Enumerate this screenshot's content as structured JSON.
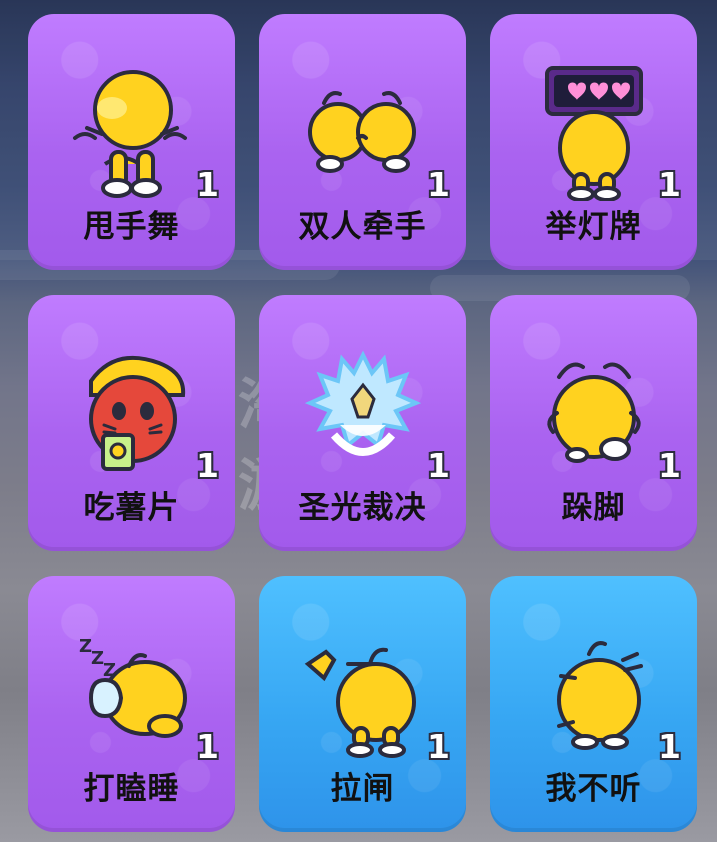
{
  "items": [
    {
      "name": "甩手舞",
      "count": "1",
      "theme": "purple",
      "icon": "dancing-chick-icon"
    },
    {
      "name": "双人牵手",
      "count": "1",
      "theme": "purple",
      "icon": "hand-holding-chicks-icon"
    },
    {
      "name": "举灯牌",
      "count": "1",
      "theme": "purple",
      "icon": "lightboard-chick-icon"
    },
    {
      "name": "吃薯片",
      "count": "1",
      "theme": "purple",
      "icon": "chips-snack-icon"
    },
    {
      "name": "圣光裁决",
      "count": "1",
      "theme": "purple",
      "icon": "holy-crown-icon"
    },
    {
      "name": "跺脚",
      "count": "1",
      "theme": "purple",
      "icon": "stomping-chick-icon"
    },
    {
      "name": "打瞌睡",
      "count": "1",
      "theme": "purple",
      "icon": "sleeping-chick-icon"
    },
    {
      "name": "拉闸",
      "count": "1",
      "theme": "blue",
      "icon": "lever-pull-chick-icon"
    },
    {
      "name": "我不听",
      "count": "1",
      "theme": "blue",
      "icon": "ignore-chick-icon"
    }
  ],
  "watermark": "淘手游",
  "colors": {
    "purple": "#aa63f0",
    "blue": "#37a7f3",
    "chick_yellow": "#ffd21f",
    "outline": "#2b2b3d"
  }
}
